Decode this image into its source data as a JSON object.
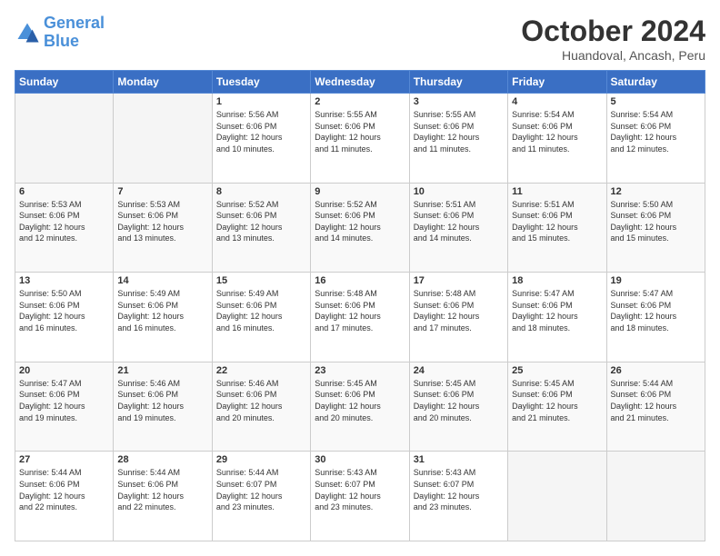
{
  "logo": {
    "line1": "General",
    "line2": "Blue"
  },
  "title": "October 2024",
  "location": "Huandoval, Ancash, Peru",
  "days_of_week": [
    "Sunday",
    "Monday",
    "Tuesday",
    "Wednesday",
    "Thursday",
    "Friday",
    "Saturday"
  ],
  "weeks": [
    [
      {
        "day": "",
        "info": ""
      },
      {
        "day": "",
        "info": ""
      },
      {
        "day": "1",
        "info": "Sunrise: 5:56 AM\nSunset: 6:06 PM\nDaylight: 12 hours\nand 10 minutes."
      },
      {
        "day": "2",
        "info": "Sunrise: 5:55 AM\nSunset: 6:06 PM\nDaylight: 12 hours\nand 11 minutes."
      },
      {
        "day": "3",
        "info": "Sunrise: 5:55 AM\nSunset: 6:06 PM\nDaylight: 12 hours\nand 11 minutes."
      },
      {
        "day": "4",
        "info": "Sunrise: 5:54 AM\nSunset: 6:06 PM\nDaylight: 12 hours\nand 11 minutes."
      },
      {
        "day": "5",
        "info": "Sunrise: 5:54 AM\nSunset: 6:06 PM\nDaylight: 12 hours\nand 12 minutes."
      }
    ],
    [
      {
        "day": "6",
        "info": "Sunrise: 5:53 AM\nSunset: 6:06 PM\nDaylight: 12 hours\nand 12 minutes."
      },
      {
        "day": "7",
        "info": "Sunrise: 5:53 AM\nSunset: 6:06 PM\nDaylight: 12 hours\nand 13 minutes."
      },
      {
        "day": "8",
        "info": "Sunrise: 5:52 AM\nSunset: 6:06 PM\nDaylight: 12 hours\nand 13 minutes."
      },
      {
        "day": "9",
        "info": "Sunrise: 5:52 AM\nSunset: 6:06 PM\nDaylight: 12 hours\nand 14 minutes."
      },
      {
        "day": "10",
        "info": "Sunrise: 5:51 AM\nSunset: 6:06 PM\nDaylight: 12 hours\nand 14 minutes."
      },
      {
        "day": "11",
        "info": "Sunrise: 5:51 AM\nSunset: 6:06 PM\nDaylight: 12 hours\nand 15 minutes."
      },
      {
        "day": "12",
        "info": "Sunrise: 5:50 AM\nSunset: 6:06 PM\nDaylight: 12 hours\nand 15 minutes."
      }
    ],
    [
      {
        "day": "13",
        "info": "Sunrise: 5:50 AM\nSunset: 6:06 PM\nDaylight: 12 hours\nand 16 minutes."
      },
      {
        "day": "14",
        "info": "Sunrise: 5:49 AM\nSunset: 6:06 PM\nDaylight: 12 hours\nand 16 minutes."
      },
      {
        "day": "15",
        "info": "Sunrise: 5:49 AM\nSunset: 6:06 PM\nDaylight: 12 hours\nand 16 minutes."
      },
      {
        "day": "16",
        "info": "Sunrise: 5:48 AM\nSunset: 6:06 PM\nDaylight: 12 hours\nand 17 minutes."
      },
      {
        "day": "17",
        "info": "Sunrise: 5:48 AM\nSunset: 6:06 PM\nDaylight: 12 hours\nand 17 minutes."
      },
      {
        "day": "18",
        "info": "Sunrise: 5:47 AM\nSunset: 6:06 PM\nDaylight: 12 hours\nand 18 minutes."
      },
      {
        "day": "19",
        "info": "Sunrise: 5:47 AM\nSunset: 6:06 PM\nDaylight: 12 hours\nand 18 minutes."
      }
    ],
    [
      {
        "day": "20",
        "info": "Sunrise: 5:47 AM\nSunset: 6:06 PM\nDaylight: 12 hours\nand 19 minutes."
      },
      {
        "day": "21",
        "info": "Sunrise: 5:46 AM\nSunset: 6:06 PM\nDaylight: 12 hours\nand 19 minutes."
      },
      {
        "day": "22",
        "info": "Sunrise: 5:46 AM\nSunset: 6:06 PM\nDaylight: 12 hours\nand 20 minutes."
      },
      {
        "day": "23",
        "info": "Sunrise: 5:45 AM\nSunset: 6:06 PM\nDaylight: 12 hours\nand 20 minutes."
      },
      {
        "day": "24",
        "info": "Sunrise: 5:45 AM\nSunset: 6:06 PM\nDaylight: 12 hours\nand 20 minutes."
      },
      {
        "day": "25",
        "info": "Sunrise: 5:45 AM\nSunset: 6:06 PM\nDaylight: 12 hours\nand 21 minutes."
      },
      {
        "day": "26",
        "info": "Sunrise: 5:44 AM\nSunset: 6:06 PM\nDaylight: 12 hours\nand 21 minutes."
      }
    ],
    [
      {
        "day": "27",
        "info": "Sunrise: 5:44 AM\nSunset: 6:06 PM\nDaylight: 12 hours\nand 22 minutes."
      },
      {
        "day": "28",
        "info": "Sunrise: 5:44 AM\nSunset: 6:06 PM\nDaylight: 12 hours\nand 22 minutes."
      },
      {
        "day": "29",
        "info": "Sunrise: 5:44 AM\nSunset: 6:07 PM\nDaylight: 12 hours\nand 23 minutes."
      },
      {
        "day": "30",
        "info": "Sunrise: 5:43 AM\nSunset: 6:07 PM\nDaylight: 12 hours\nand 23 minutes."
      },
      {
        "day": "31",
        "info": "Sunrise: 5:43 AM\nSunset: 6:07 PM\nDaylight: 12 hours\nand 23 minutes."
      },
      {
        "day": "",
        "info": ""
      },
      {
        "day": "",
        "info": ""
      }
    ]
  ]
}
